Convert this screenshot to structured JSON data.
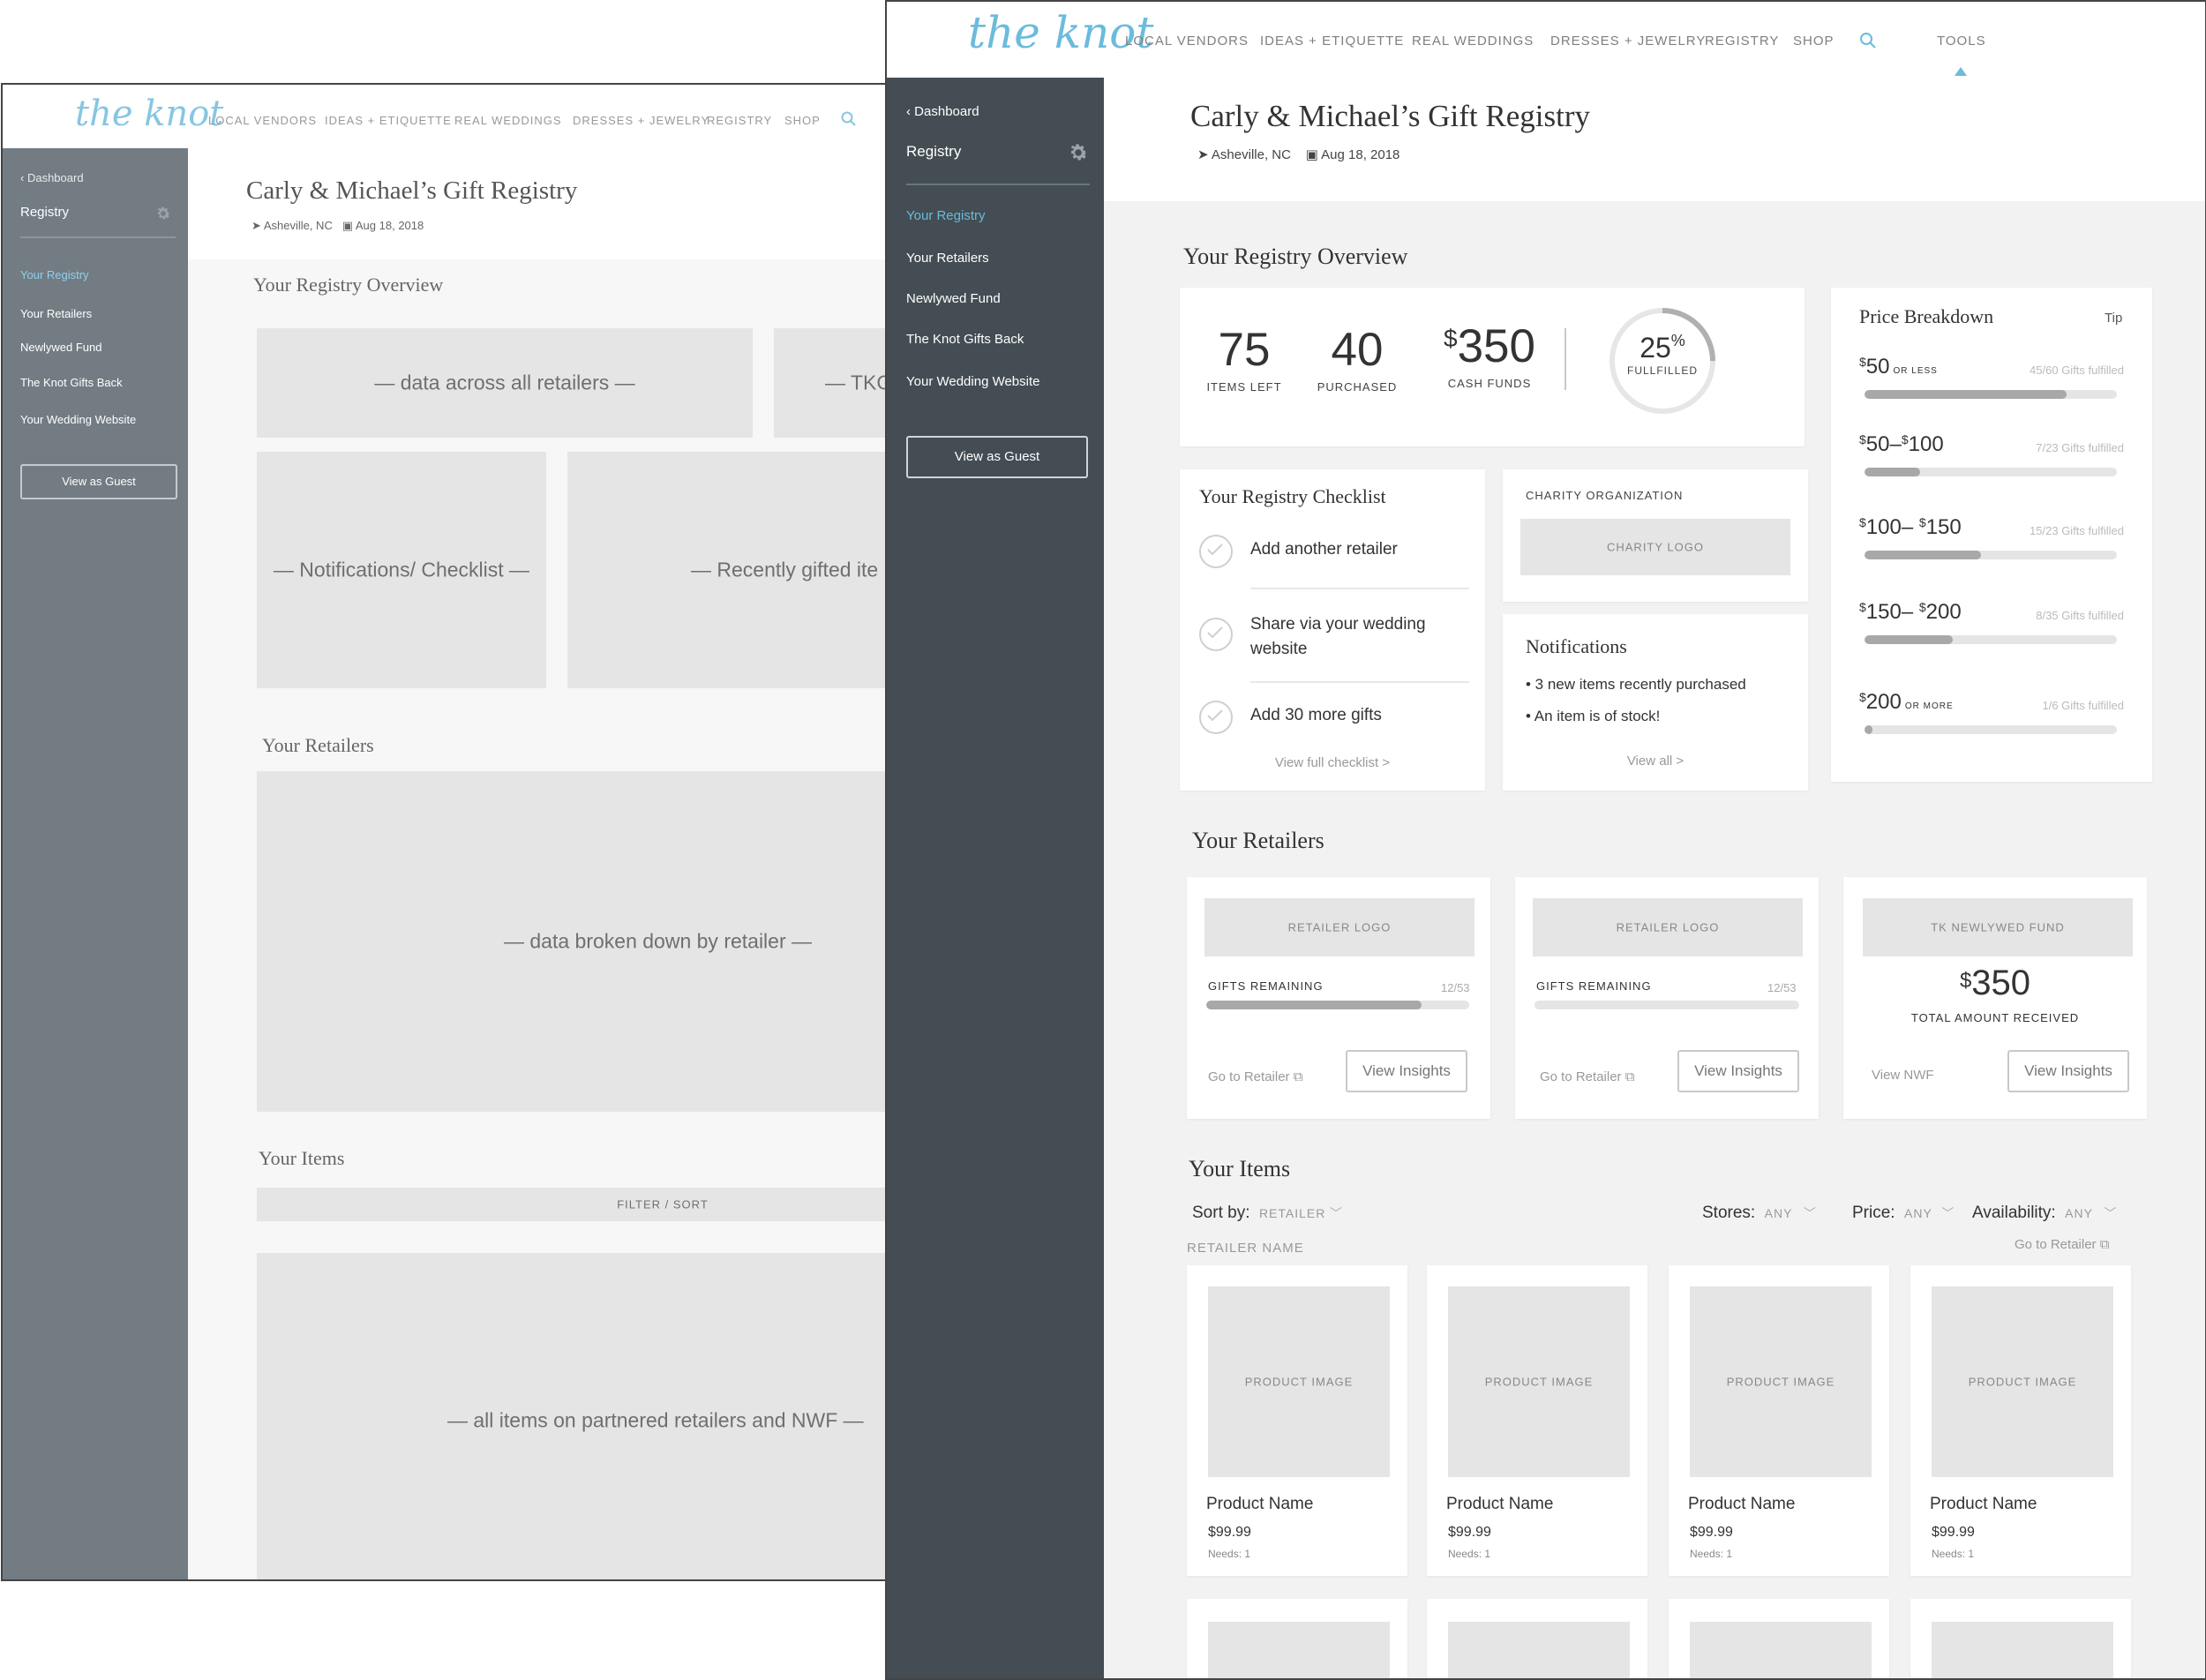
{
  "brand": {
    "logo": "the knot",
    "color": "#6bbbdc"
  },
  "nav": {
    "items": [
      "LOCAL VENDORS",
      "IDEAS + ETIQUETTE",
      "REAL WEDDINGS",
      "DRESSES + JEWELRY",
      "REGISTRY",
      "SHOP"
    ],
    "tools": "TOOLS"
  },
  "registry": {
    "title": "Carly & Michael’s Gift Registry",
    "location": "Asheville, NC",
    "date": "Aug 18, 2018"
  },
  "sidebar": {
    "back": "Dashboard",
    "section": "Registry",
    "items": [
      "Your Registry",
      "Your Retailers",
      "Newlywed Fund",
      "The Knot Gifts Back",
      "Your Wedding Website"
    ],
    "guest_button": "View as Guest"
  },
  "wireframe": {
    "overview_title": "Your Registry Overview",
    "box1": "— data across all retailers —",
    "box2": "— TKG",
    "box3": "— Notifications/ Checklist —",
    "box4": "— Recently gifted ite",
    "retailers_title": "Your Retailers",
    "retailers_box": "— data broken down by retailer —",
    "items_title": "Your Items",
    "filter": "FILTER / SORT",
    "items_box": "— all items on partnered retailers and NWF —"
  },
  "overview": {
    "title": "Your Registry Overview",
    "stats": [
      {
        "value": "75",
        "label": "ITEMS LEFT"
      },
      {
        "value": "40",
        "label": "PURCHASED"
      },
      {
        "prefix": "$",
        "value": "350",
        "label": "CASH FUNDS"
      }
    ],
    "fulfilled": {
      "value": "25",
      "suffix": "%",
      "label": "FULLFILLED",
      "percent": 25
    }
  },
  "price_breakdown": {
    "title": "Price Breakdown",
    "tip": "Tip",
    "rows": [
      {
        "a": "50",
        "sep": "",
        "b": "",
        "suffix": "OR LESS",
        "note": "45/60 Gifts fulfilled",
        "fraction": 0.8
      },
      {
        "a": "50",
        "sep": "–",
        "b": "100",
        "suffix": "",
        "note": "7/23 Gifts fulfilled",
        "fraction": 0.22
      },
      {
        "a": "100",
        "sep": "– ",
        "b": "150",
        "suffix": "",
        "note": "15/23 Gifts fulfilled",
        "fraction": 0.46
      },
      {
        "a": "150",
        "sep": "– ",
        "b": "200",
        "suffix": "",
        "note": "8/35 Gifts fulfilled",
        "fraction": 0.35
      },
      {
        "a": "200",
        "sep": "",
        "b": "",
        "suffix": "OR MORE",
        "note": "1/6 Gifts fulfilled",
        "fraction": 0.03
      }
    ]
  },
  "checklist": {
    "title": "Your Registry Checklist",
    "items": [
      "Add another retailer",
      "Share via your wedding",
      "website",
      "Add 30 more gifts"
    ],
    "link": "View full checklist >"
  },
  "charity": {
    "label": "CHARITY ORGANIZATION",
    "logo": "CHARITY LOGO"
  },
  "notifications": {
    "title": "Notifications",
    "items": [
      "• 3 new items recently purchased",
      "• An item is of stock!"
    ],
    "link": "View all >"
  },
  "retailers": {
    "title": "Your Retailers",
    "cards": [
      {
        "logo": "RETAILER LOGO",
        "label": "GIFTS REMAINING",
        "count": "12/53",
        "fraction": 0.82,
        "link": "Go to Retailer",
        "button": "View Insights"
      },
      {
        "logo": "RETAILER LOGO",
        "label": "GIFTS REMAINING",
        "count": "12/53",
        "fraction": 0,
        "link": "Go to Retailer",
        "button": "View Insights"
      }
    ],
    "fund": {
      "logo": "TK NEWLYWED FUND",
      "prefix": "$",
      "amount": "350",
      "label": "TOTAL AMOUNT RECEIVED",
      "link": "View NWF",
      "button": "View Insights"
    }
  },
  "items": {
    "title": "Your Items",
    "sort_label": "Sort by:",
    "sort_value": "RETAILER",
    "filters": [
      {
        "label": "Stores:",
        "value": "ANY"
      },
      {
        "label": "Price:",
        "value": "ANY"
      },
      {
        "label": "Availability:",
        "value": "ANY"
      }
    ],
    "group": "RETAILER NAME",
    "group_link": "Go to Retailer",
    "products": [
      {
        "image": "PRODUCT IMAGE",
        "name": "Product Name",
        "price": "$99.99",
        "needs": "Needs: 1"
      },
      {
        "image": "PRODUCT IMAGE",
        "name": "Product Name",
        "price": "$99.99",
        "needs": "Needs: 1"
      },
      {
        "image": "PRODUCT IMAGE",
        "name": "Product Name",
        "price": "$99.99",
        "needs": "Needs: 1"
      },
      {
        "image": "PRODUCT IMAGE",
        "name": "Product Name",
        "price": "$99.99",
        "needs": "Needs: 1"
      }
    ]
  },
  "colors": {
    "accent": "#6bbbdc",
    "sidebar_dark": "#434d53",
    "sidebar_light": "#727c82",
    "content_bg": "#f2f2f2"
  }
}
